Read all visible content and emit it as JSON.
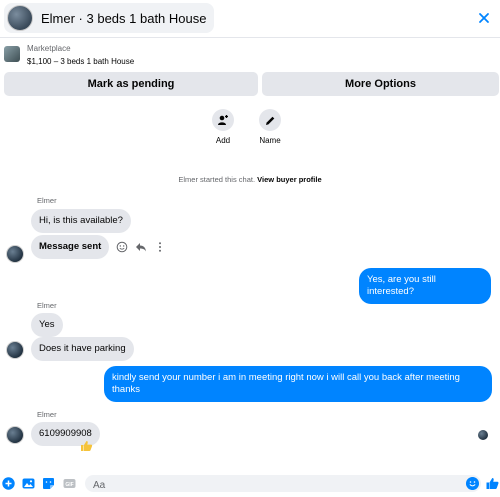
{
  "header": {
    "title": "Elmer · 3 beds 1 bath House",
    "close_icon": "close-icon"
  },
  "marketplace": {
    "label": "Marketplace",
    "listing": "$1,100 – 3 beds 1 bath House"
  },
  "buttons": {
    "pending": "Mark as pending",
    "more": "More Options"
  },
  "actions": {
    "add": "Add",
    "name": "Name"
  },
  "system": {
    "started": "Elmer started this chat.",
    "profile_link": "View buyer profile"
  },
  "messages": {
    "sender1": "Elmer",
    "m1": "Hi, is this available?",
    "m2": "Message sent",
    "m3": "Yes, are you still interested?",
    "sender2": "Elmer",
    "m4": "Yes",
    "m5": "Does it have parking",
    "m6": "kindly send your number i am in meeting right now i will call you back after meeting thanks",
    "sender3": "Elmer",
    "m7": "6109909908"
  },
  "composer": {
    "placeholder": "Aa",
    "icons": [
      "plus-icon",
      "photo-icon",
      "sticker-icon",
      "gif-icon",
      "emoji-icon",
      "like-icon"
    ]
  },
  "colors": {
    "accent": "#0084ff",
    "bubble_in": "#e4e6eb"
  }
}
